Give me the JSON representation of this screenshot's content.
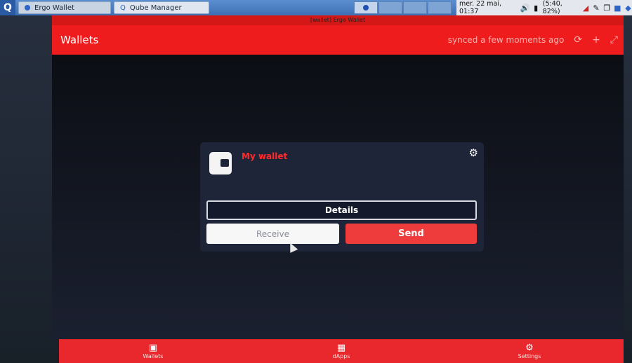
{
  "taskbar": {
    "menu_label": "Q",
    "tasks": [
      {
        "label": "Ergo Wallet"
      },
      {
        "label": "Qube Manager"
      }
    ],
    "clock": "mer. 22 mai, 01:37",
    "battery": "(5:40, 82%)"
  },
  "window": {
    "title": "[wallet] Ergo Wallet"
  },
  "header": {
    "title": "Wallets",
    "sync_status": "synced a few moments ago",
    "refresh_icon": "refresh-icon",
    "add_icon": "plus-icon",
    "expand_icon": "expand-icon"
  },
  "wallet_card": {
    "name": "My wallet",
    "details_label": "Details",
    "receive_label": "Receive",
    "send_label": "Send"
  },
  "bottom_nav": {
    "items": [
      {
        "label": "Wallets",
        "icon": "wallet-icon"
      },
      {
        "label": "dApps",
        "icon": "grid-icon"
      },
      {
        "label": "Settings",
        "icon": "gear-icon"
      }
    ]
  },
  "colors": {
    "accent": "#ee1c1c",
    "card_bg": "#1e2538",
    "content_bg": "#0c0e14"
  }
}
